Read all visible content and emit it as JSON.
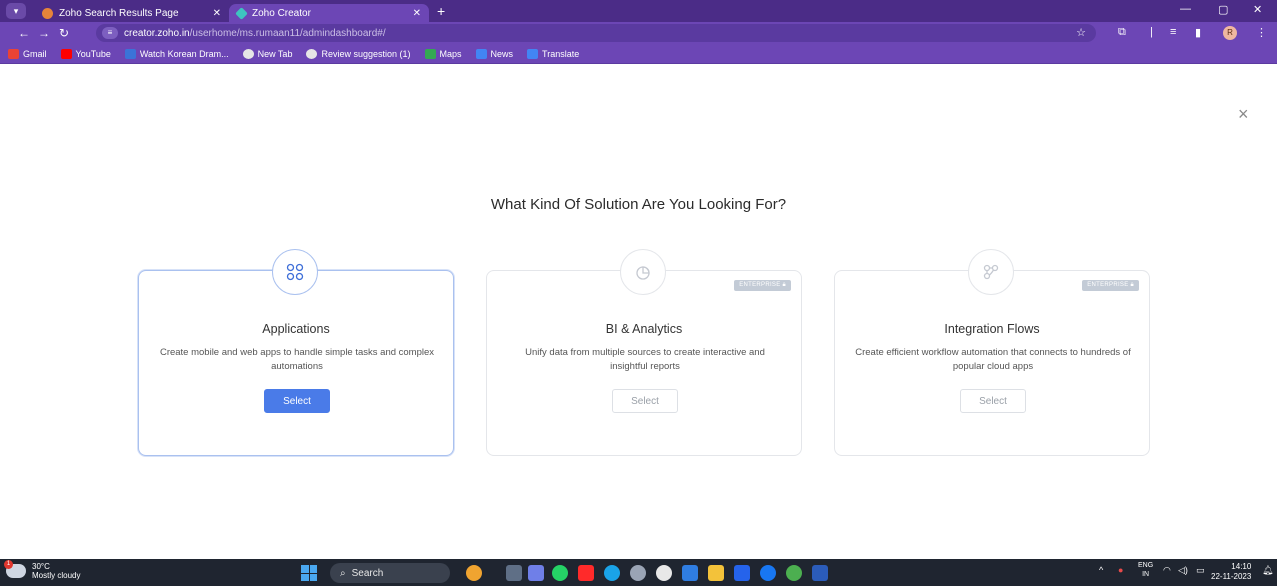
{
  "browser": {
    "tabs": [
      {
        "title": "Zoho Search Results Page",
        "active": false
      },
      {
        "title": "Zoho Creator",
        "active": true
      }
    ],
    "new_tab_glyph": "+",
    "url_host": "creator.zoho.in",
    "url_path": "/userhome/ms.rumaan11/admindashboard#/",
    "profile_initial": "R",
    "bookmarks": [
      "Gmail",
      "YouTube",
      "Watch Korean Dram...",
      "New Tab",
      "Review suggestion (1)",
      "Maps",
      "News",
      "Translate"
    ]
  },
  "page": {
    "heading": "What Kind Of Solution Are You Looking For?",
    "close_glyph": "×",
    "cards": [
      {
        "title": "Applications",
        "description": "Create mobile and web apps to handle simple tasks and complex automations",
        "button": "Select",
        "icon": "apps-grid-icon",
        "badge": ""
      },
      {
        "title": "BI & Analytics",
        "description": "Unify data from multiple sources to create interactive and insightful reports",
        "button": "Select",
        "icon": "analytics-pie-icon",
        "badge": "ENTERPRISE"
      },
      {
        "title": "Integration Flows",
        "description": "Create efficient workflow automation that connects to hundreds of popular cloud apps",
        "button": "Select",
        "icon": "integration-flow-icon",
        "badge": "ENTERPRISE"
      }
    ]
  },
  "taskbar": {
    "temperature": "30°C",
    "weather": "Mostly cloudy",
    "weather_badge": "1",
    "search_label": "Search",
    "lang_top": "ENG",
    "lang_bottom": "IN",
    "time": "14:10",
    "date": "22-11-2023"
  },
  "colors": {
    "chrome": "#6c46b5",
    "primary_button": "#4a7be8",
    "selected_border": "#aac1ef",
    "taskbar": "#1f2530"
  }
}
